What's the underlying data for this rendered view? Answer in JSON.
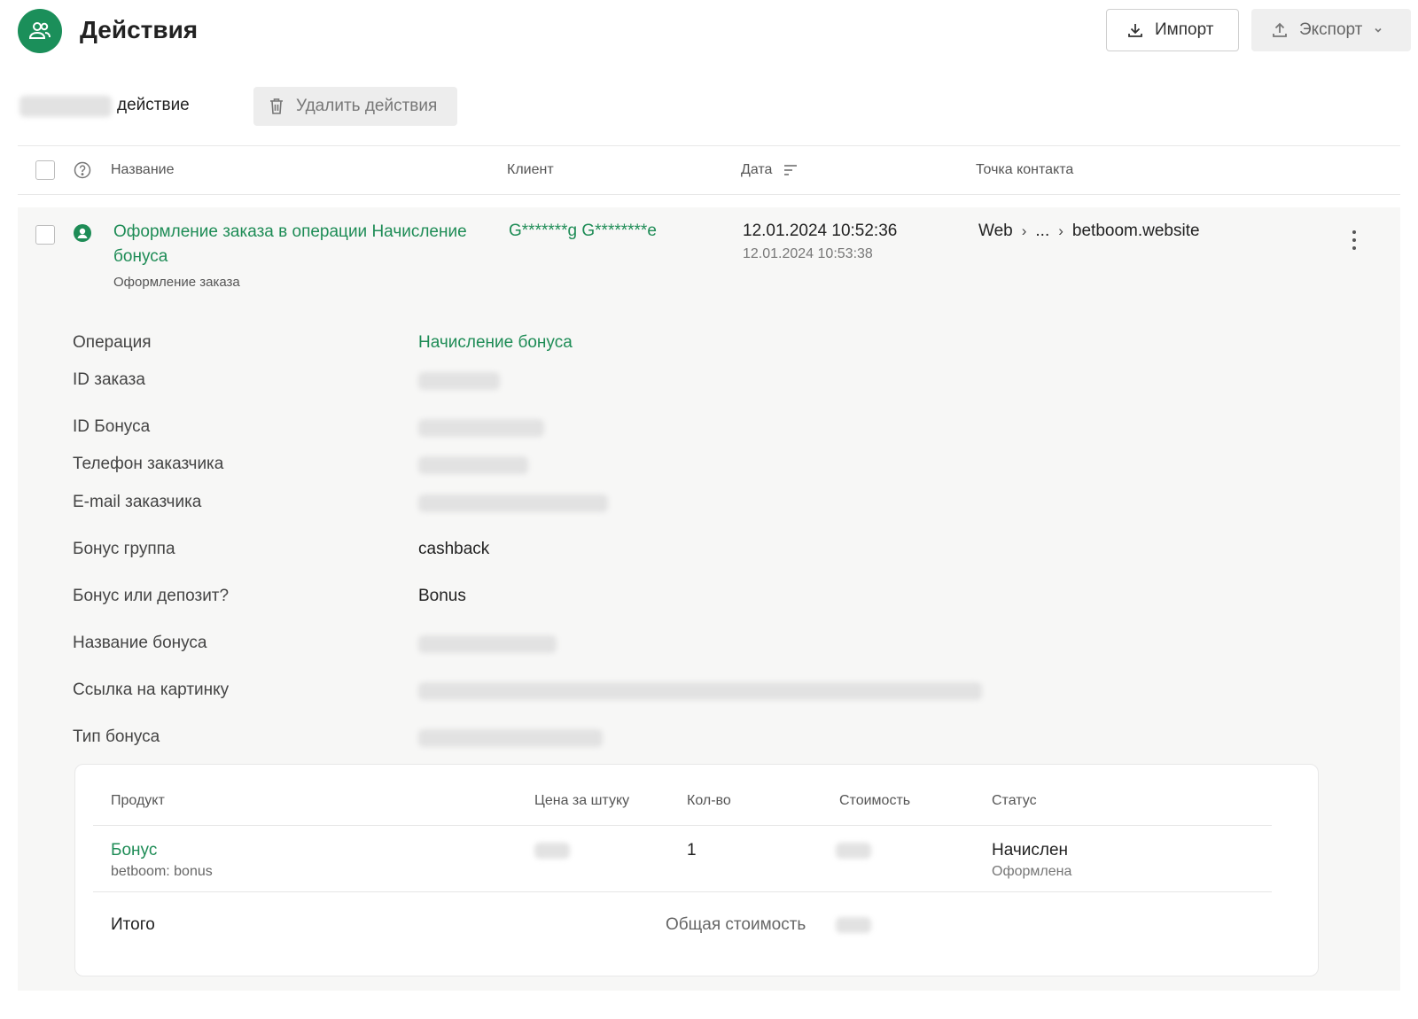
{
  "header": {
    "title": "Действия",
    "logo_icon": "users-icon",
    "import_label": "Импорт",
    "export_label": "Экспорт"
  },
  "toolbar": {
    "action_suffix": "действие",
    "delete_label": "Удалить действия"
  },
  "table": {
    "columns": {
      "name": "Название",
      "client": "Клиент",
      "date": "Дата",
      "contact_point": "Точка контакта"
    },
    "rows": [
      {
        "title": "Оформление заказа в операции Начисление бонуса",
        "subtitle": "Оформление заказа",
        "client": "G*******g G********e",
        "date": "12.01.2024 10:52:36",
        "date_secondary": "12.01.2024 10:53:38",
        "contact": {
          "start": "Web",
          "middle": "...",
          "end": "betboom.website"
        }
      }
    ]
  },
  "details": {
    "fields": [
      {
        "label": "Операция",
        "value": "Начисление бонуса"
      },
      {
        "label": "ID заказа",
        "value": ""
      },
      {
        "label": "ID Бонуса",
        "value": ""
      },
      {
        "label": "Телефон заказчика",
        "value": ""
      },
      {
        "label": "E-mail заказчика",
        "value": ""
      },
      {
        "label": "Бонус группа",
        "value": "cashback"
      },
      {
        "label": "Бонус или депозит?",
        "value": "Bonus"
      },
      {
        "label": "Название бонуса",
        "value": ""
      },
      {
        "label": "Ссылка на картинку",
        "value": ""
      },
      {
        "label": "Тип бонуса",
        "value": ""
      }
    ],
    "products": {
      "columns": {
        "product": "Продукт",
        "unit_price": "Цена за штуку",
        "quantity": "Кол-во",
        "cost": "Стоимость",
        "status": "Статус"
      },
      "items": [
        {
          "name": "Бонус",
          "sub": "betboom: bonus",
          "quantity": "1",
          "status": "Начислен",
          "status_sub": "Оформлена"
        }
      ],
      "total_label": "Итого",
      "total_cost_label": "Общая стоимость"
    }
  },
  "colors": {
    "accent": "#1e8c56",
    "logo": "#1b8f5a"
  }
}
